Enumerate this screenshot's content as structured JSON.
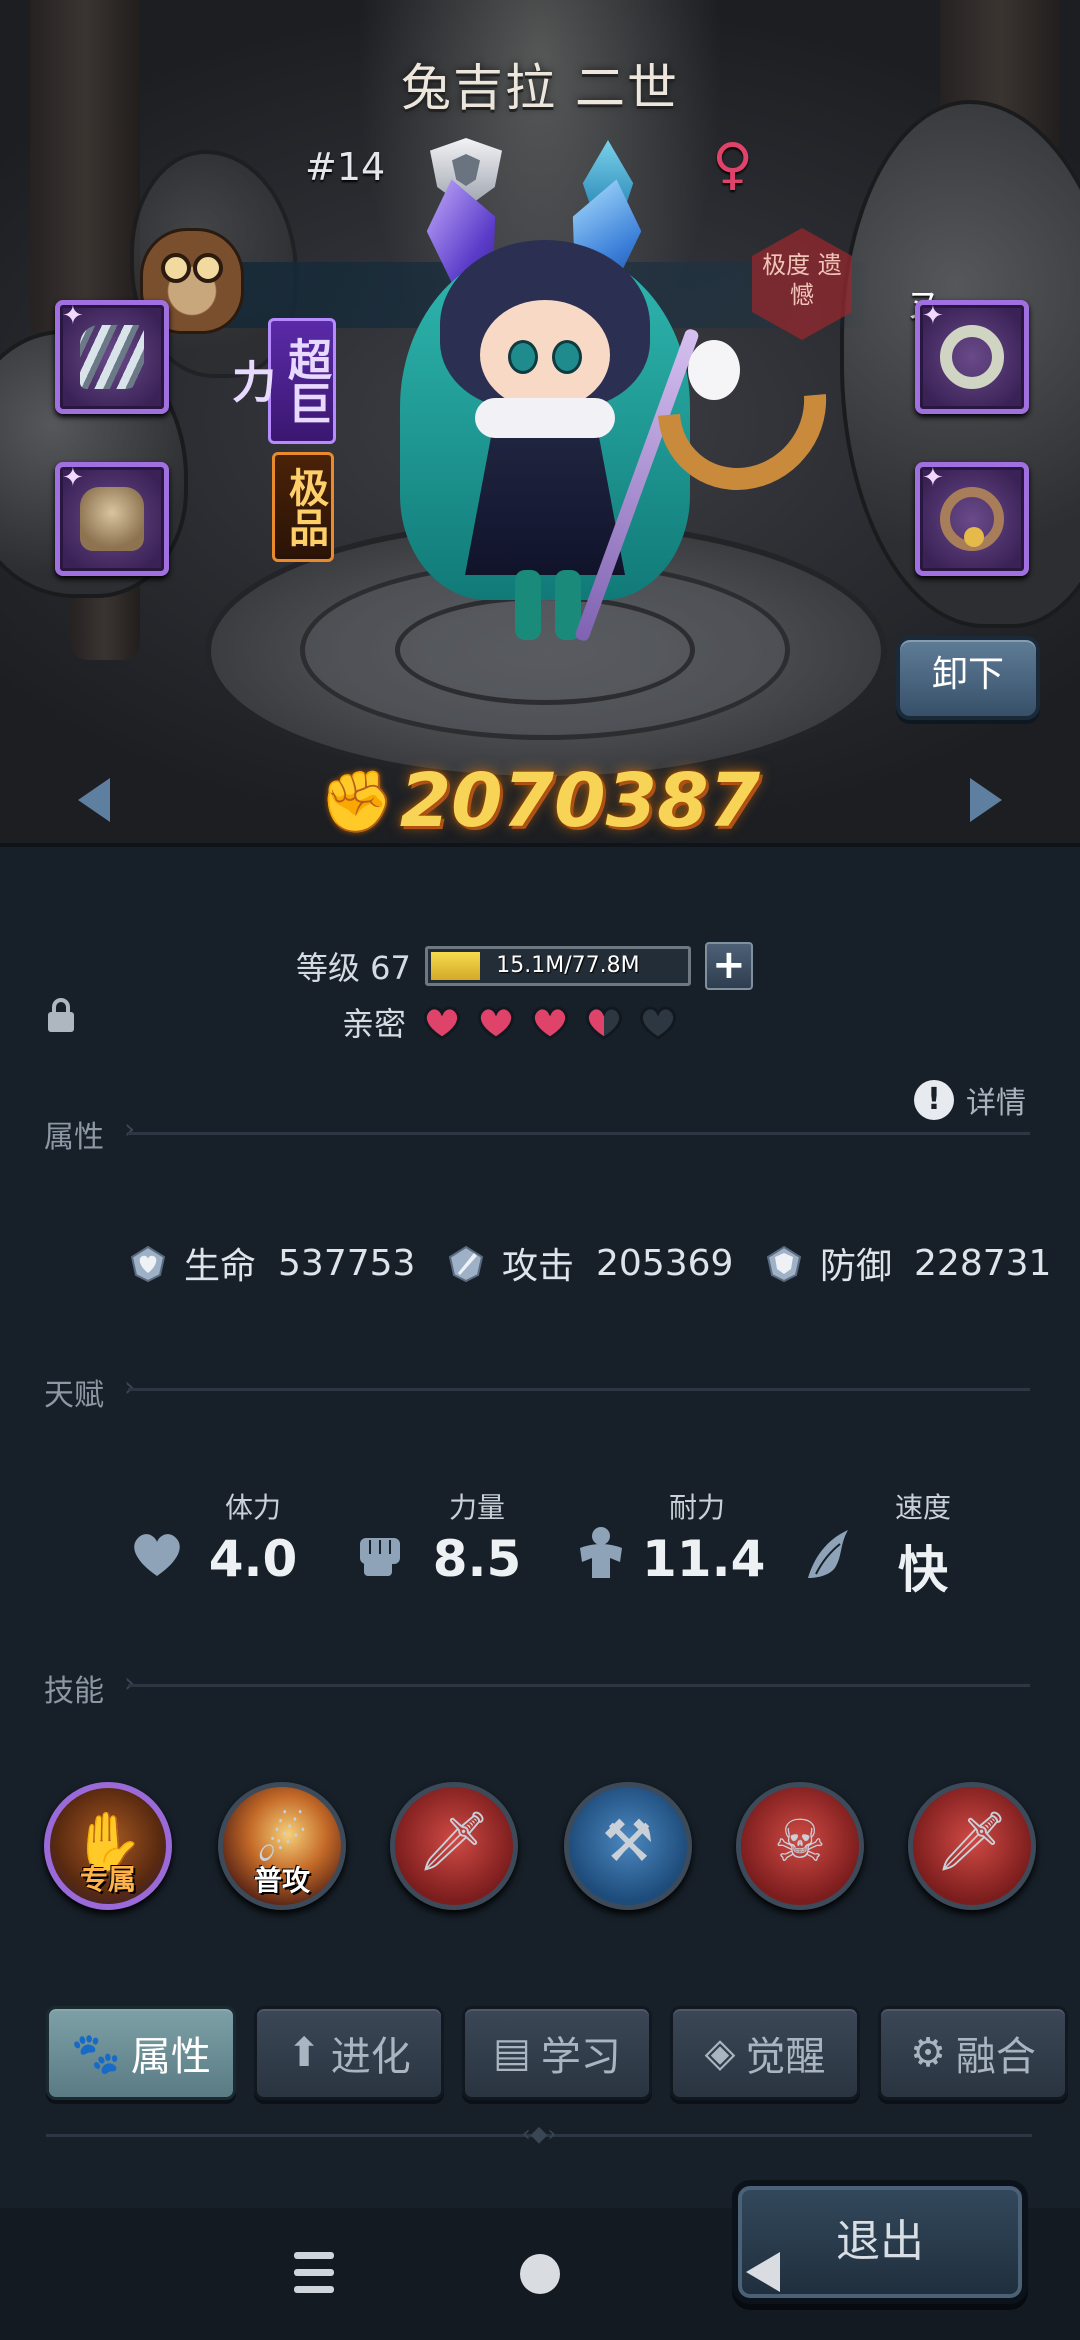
{
  "character": {
    "name": "兔吉拉 二世",
    "rank": "#14",
    "gender_symbol": "♀",
    "tag_vertical": "超巨力",
    "tag_quality": "极品",
    "stamp_text": "极度 遗憾",
    "stamp_tag": "ヌ"
  },
  "scene": {
    "unequip_label": "卸下",
    "power_icon": "power-fist-icon",
    "power_value": "2070387"
  },
  "equipment": [
    {
      "slot": "left-1",
      "icon": "claw-icon"
    },
    {
      "slot": "left-2",
      "icon": "armor-icon"
    },
    {
      "slot": "right-1",
      "icon": "ring-icon"
    },
    {
      "slot": "right-2",
      "icon": "bell-collar-icon"
    }
  ],
  "level": {
    "label": "等级 67",
    "xp_text": "15.1M/77.8M",
    "xp_fraction": 0.194,
    "plus_label": "+"
  },
  "intimacy": {
    "label": "亲密",
    "hearts": [
      "full",
      "full",
      "full",
      "half",
      "empty"
    ]
  },
  "sections": {
    "attributes": "属性",
    "talents": "天赋",
    "skills": "技能",
    "details_icon": "!",
    "details_label": "详情"
  },
  "stats": [
    {
      "icon": "heart-gem-icon",
      "label": "生命",
      "value": "537753"
    },
    {
      "icon": "sword-gem-icon",
      "label": "攻击",
      "value": "205369"
    },
    {
      "icon": "shield-gem-icon",
      "label": "防御",
      "value": "228731"
    }
  ],
  "talents": [
    {
      "icon": "heart-icon",
      "label": "体力",
      "value": "4.0"
    },
    {
      "icon": "fist-icon",
      "label": "力量",
      "value": "8.5"
    },
    {
      "icon": "muscle-icon",
      "label": "耐力",
      "value": "11.4"
    },
    {
      "icon": "wing-icon",
      "label": "速度",
      "value": "快"
    }
  ],
  "skills": [
    {
      "name": "exclusive",
      "caption": "专属",
      "glyph": "✋"
    },
    {
      "name": "normal-attack",
      "caption": "普攻",
      "glyph": "☄"
    },
    {
      "name": "sword-1",
      "caption": "",
      "glyph": "🗡"
    },
    {
      "name": "hammer",
      "caption": "",
      "glyph": "⚒"
    },
    {
      "name": "skull",
      "caption": "",
      "glyph": "☠"
    },
    {
      "name": "sword-2",
      "caption": "",
      "glyph": "🗡"
    }
  ],
  "tabs": [
    {
      "label": "属性",
      "icon": "paw-icon",
      "active": true
    },
    {
      "label": "进化",
      "icon": "arrow-up-icon",
      "active": false
    },
    {
      "label": "学习",
      "icon": "book-icon",
      "active": false
    },
    {
      "label": "觉醒",
      "icon": "wolf-icon",
      "active": false
    },
    {
      "label": "融合",
      "icon": "fusion-icon",
      "active": false
    }
  ],
  "exit_label": "退出",
  "colors": {
    "background": "#172029",
    "power": "#f7d455",
    "heart": "#e0436a",
    "active_tab": "#6d8f96",
    "xp_fill": "#f6dc4e"
  }
}
